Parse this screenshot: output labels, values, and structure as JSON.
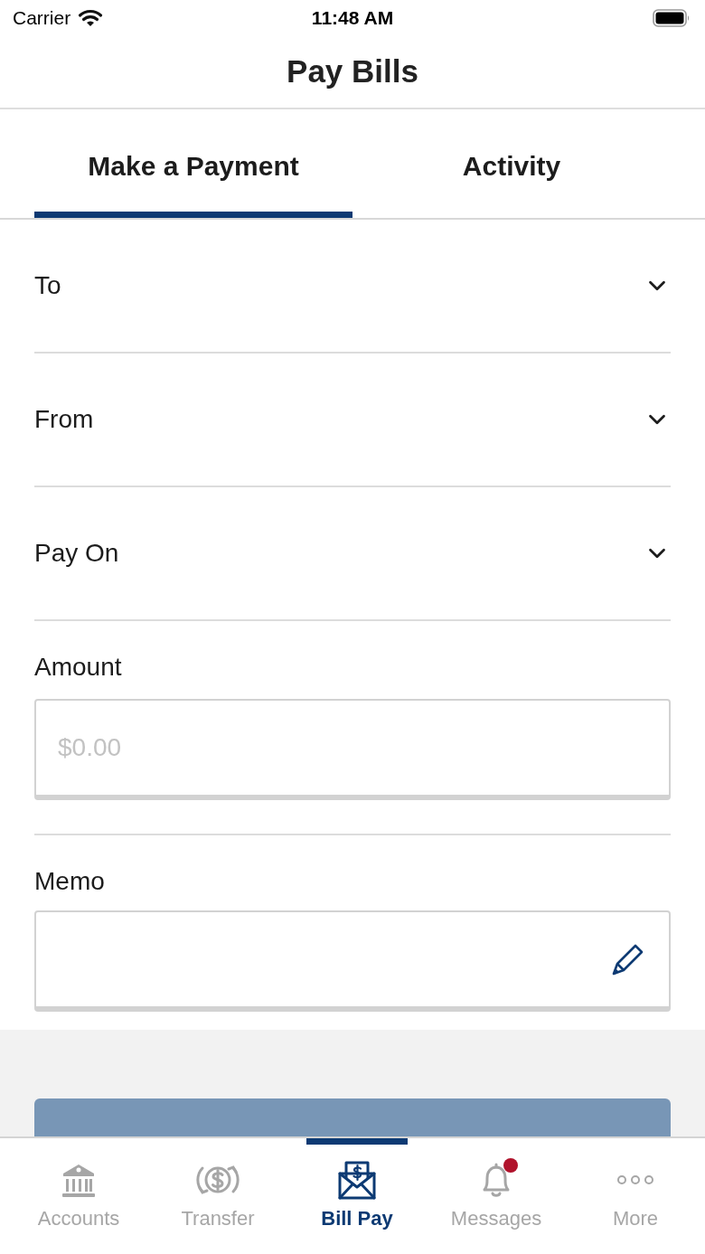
{
  "status_bar": {
    "carrier": "Carrier",
    "time": "11:48 AM"
  },
  "header": {
    "title": "Pay Bills"
  },
  "tabs": [
    {
      "label": "Make a Payment",
      "selected": true
    },
    {
      "label": "Activity",
      "selected": false
    }
  ],
  "form": {
    "fields": [
      {
        "kind": "dropdown",
        "label": "To"
      },
      {
        "kind": "dropdown",
        "label": "From"
      },
      {
        "kind": "dropdown",
        "label": "Pay On"
      },
      {
        "kind": "text",
        "label": "Amount",
        "placeholder": "$0.00"
      },
      {
        "kind": "memo",
        "label": "Memo"
      }
    ]
  },
  "continue_button": {
    "disabled": true
  },
  "tab_bar": {
    "items": [
      {
        "label": "Accounts",
        "selected": false,
        "badge": false
      },
      {
        "label": "Transfer",
        "selected": false,
        "badge": false
      },
      {
        "label": "Bill Pay",
        "selected": true,
        "badge": false
      },
      {
        "label": "Messages",
        "selected": false,
        "badge": true
      },
      {
        "label": "More",
        "selected": false,
        "badge": false
      }
    ]
  }
}
